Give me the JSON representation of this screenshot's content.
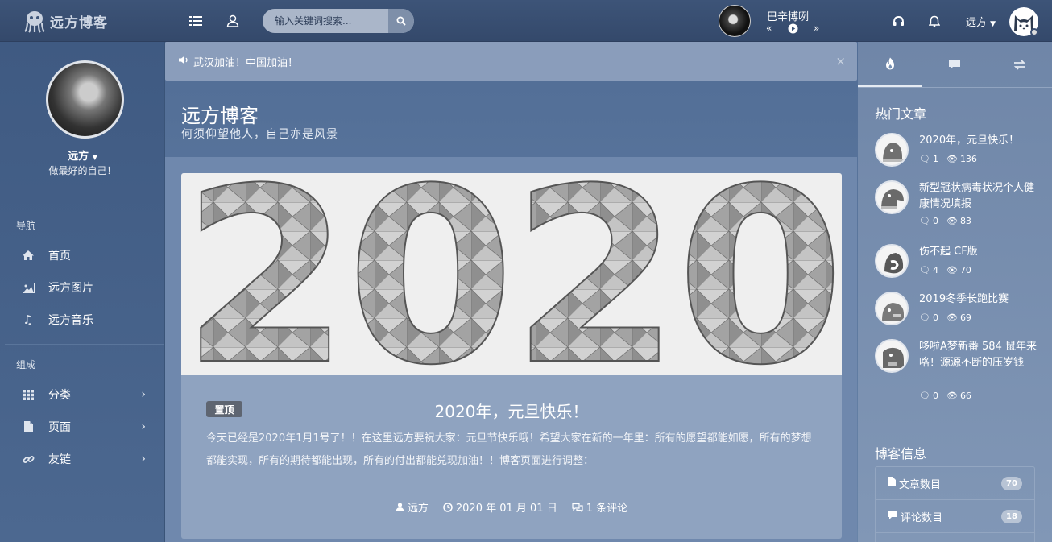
{
  "header": {
    "logo_text": "远方博客",
    "search_placeholder": "输入关键词搜索...",
    "music": {
      "title": "巴辛博咧"
    },
    "user_name": "远方"
  },
  "sidebar": {
    "user_name": "远方",
    "motto": "做最好的自己！",
    "nav_heading": "导航",
    "nav_items": [
      {
        "label": "首页",
        "icon": "home-icon"
      },
      {
        "label": "远方图片",
        "icon": "image-icon"
      },
      {
        "label": "远方音乐",
        "icon": "music-icon"
      }
    ],
    "compose_heading": "组成",
    "compose_items": [
      {
        "label": "分类",
        "icon": "grid-icon"
      },
      {
        "label": "页面",
        "icon": "file-icon"
      },
      {
        "label": "友链",
        "icon": "link-icon"
      }
    ]
  },
  "notice": {
    "text": "武汉加油！中国加油！",
    "close": "×"
  },
  "hero": {
    "title": "远方博客",
    "subtitle": "何须仰望他人，自己亦是风景"
  },
  "post": {
    "badge": "置顶",
    "image_text": "2020",
    "title": "2020年，元旦快乐！",
    "excerpt": "今天已经是2020年1月1号了！！在这里远方要祝大家：元旦节快乐哦！希望大家在新的一年里：所有的愿望都能如愿，所有的梦想都能实现，所有的期待都能出现，所有的付出都能兑现加油！！博客页面进行调整：",
    "author": "远方",
    "date": "2020 年 01 月 01 日",
    "comments": "1 条评论"
  },
  "right": {
    "hot_heading": "热门文章",
    "hot_posts": [
      {
        "title": "2020年，元旦快乐！",
        "comments": "1",
        "views": "136"
      },
      {
        "title": "新型冠状病毒状况个人健康情况填报",
        "comments": "0",
        "views": "83"
      },
      {
        "title": "伤不起 CF版",
        "comments": "4",
        "views": "70"
      },
      {
        "title": "2019冬季长跑比赛",
        "comments": "0",
        "views": "69"
      },
      {
        "title": "哆啦A梦新番 584 鼠年来咯！源源不断的压岁钱",
        "comments": "0",
        "views": "66"
      }
    ],
    "info_heading": "博客信息",
    "info_items": [
      {
        "label": "文章数目",
        "value": "70"
      },
      {
        "label": "评论数目",
        "value": "18"
      }
    ]
  },
  "colors": {
    "header": "#3d5478",
    "accent": "#8fa3c0",
    "badge": "#5e6571"
  }
}
